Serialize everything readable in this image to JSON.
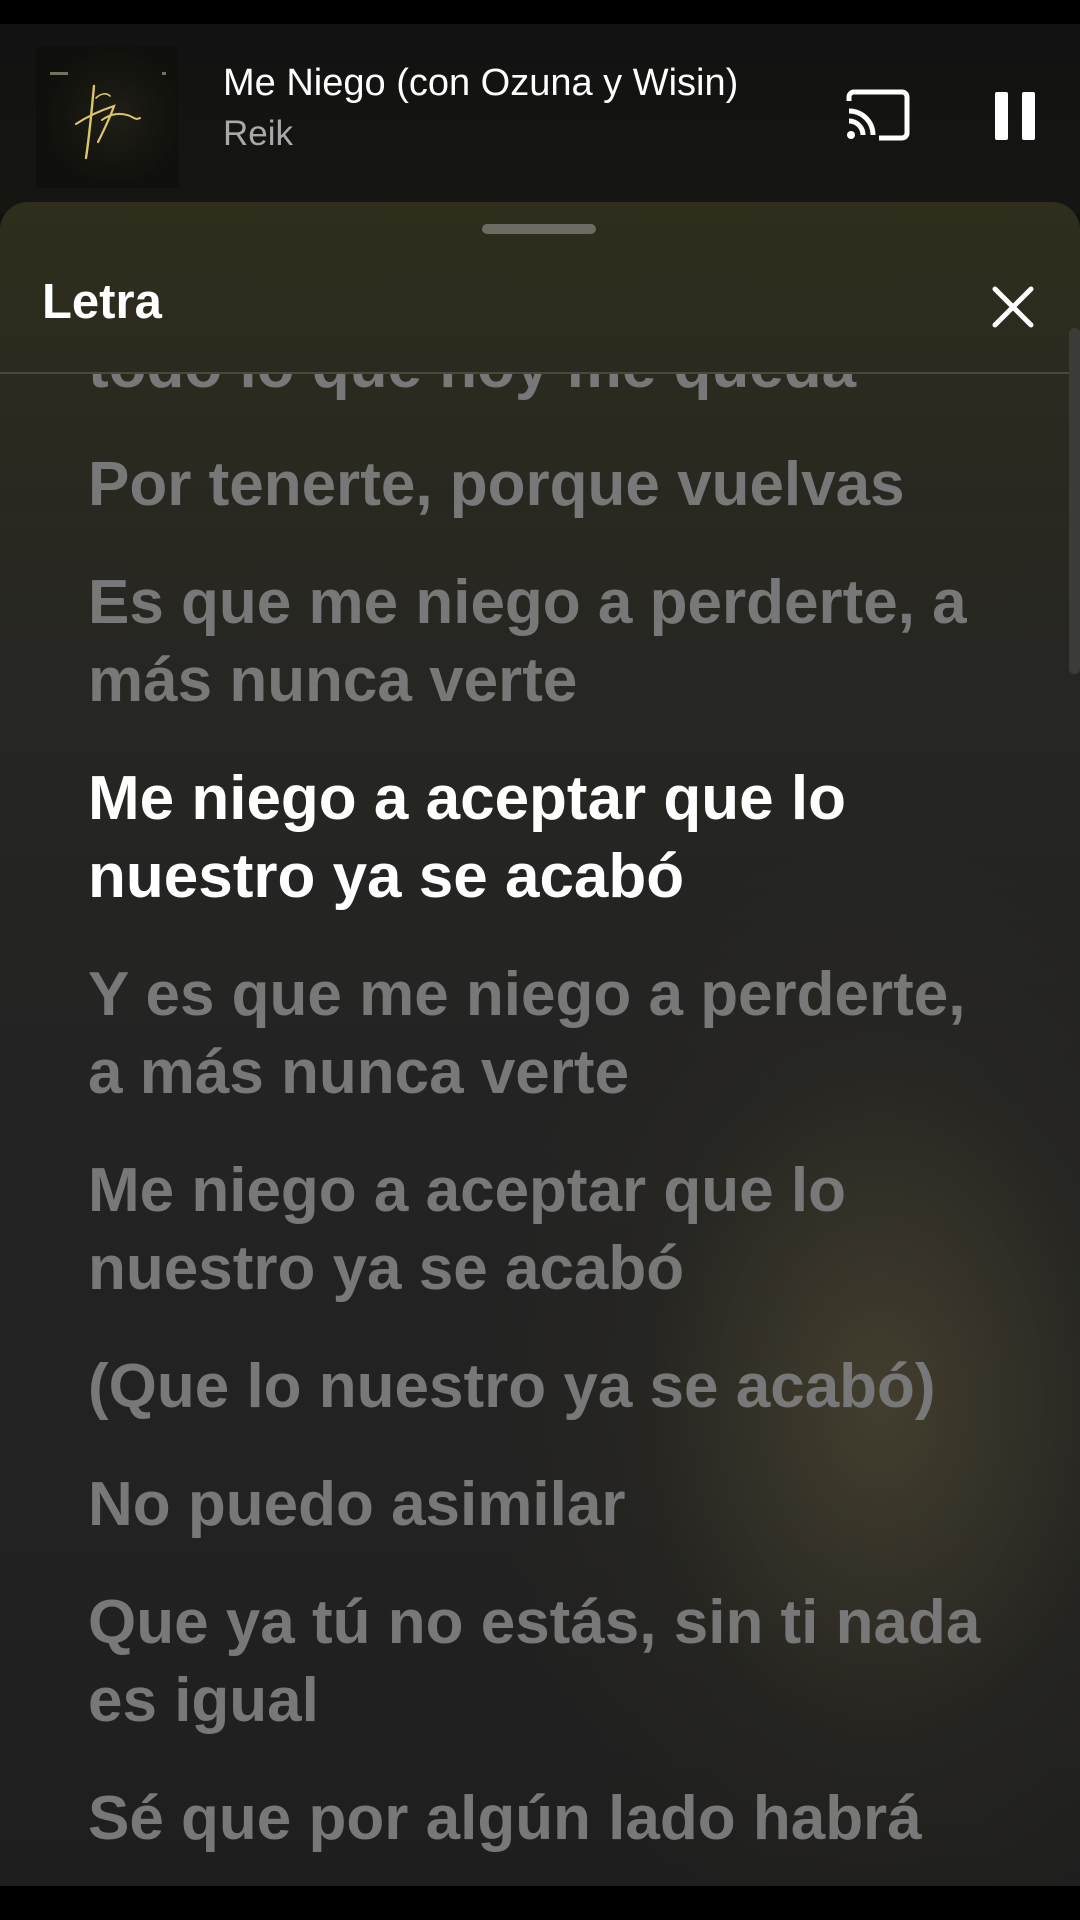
{
  "mini_player": {
    "title": "Me Niego (con Ozuna y Wisin)",
    "artist": "Reik",
    "album_art": "album-cover-signature",
    "cast_icon": "cast-icon",
    "pause_icon": "pause-icon"
  },
  "lyrics_sheet": {
    "title": "Letra",
    "close_icon": "close-icon",
    "lines": [
      "todo lo que hoy me queda",
      "Por tenerte, porque vuelvas",
      "Es que me niego a perderte, a más nunca verte",
      "Me niego a aceptar que lo nuestro ya se acabó",
      "Y es que me niego a perderte, a más nunca verte",
      "Me niego a aceptar que lo nuestro ya se acabó",
      "(Que lo nuestro ya se acabó)",
      "No puedo asimilar",
      "Que ya tú no estás, sin ti nada es igual",
      "Sé que por algún lado habrá"
    ],
    "active_line_index": 3
  },
  "colors": {
    "active_lyric": "#ffffff",
    "inactive_lyric": "#787878",
    "artist_text": "#a9a9a9",
    "sheet_top": "#2f2d1c"
  }
}
